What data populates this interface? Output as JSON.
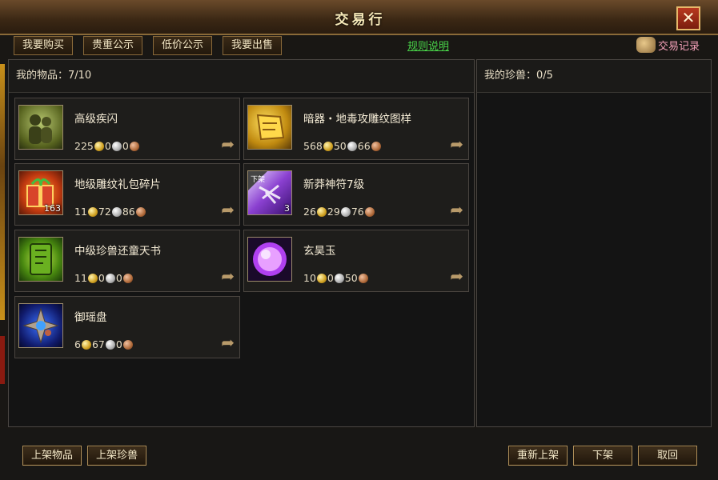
{
  "window": {
    "title": "交易行",
    "close_label": "✕"
  },
  "tabs": [
    {
      "label": "我要购买"
    },
    {
      "label": "贵重公示"
    },
    {
      "label": "低价公示"
    },
    {
      "label": "我要出售"
    }
  ],
  "rules_link": "规则说明",
  "records": {
    "label": "交易记录",
    "icon": "scroll-icon"
  },
  "left_panel": {
    "header": "我的物品：7/10"
  },
  "right_panel": {
    "header": "我的珍兽：0/5"
  },
  "items": [
    {
      "name": "高级疾闪",
      "count": "",
      "gold": "225",
      "silver": "0",
      "copper": "0",
      "icon": "shadow-figures-icon"
    },
    {
      "name": "暗器・地毒攻雕纹图样",
      "count": "",
      "gold": "568",
      "silver": "50",
      "copper": "66",
      "icon": "golden-scroll-icon"
    },
    {
      "name": "地级雕纹礼包碎片",
      "count": "163",
      "gold": "11",
      "silver": "72",
      "copper": "86",
      "icon": "gift-box-icon"
    },
    {
      "name": "新莽神符7级",
      "count": "3",
      "gold": "26",
      "silver": "29",
      "copper": "76",
      "icon": "talisman-icon",
      "badge": "下架"
    },
    {
      "name": "中级珍兽还童天书",
      "count": "",
      "gold": "11",
      "silver": "0",
      "copper": "0",
      "icon": "green-book-icon"
    },
    {
      "name": "玄昊玉",
      "count": "",
      "gold": "10",
      "silver": "0",
      "copper": "50",
      "icon": "purple-orb-icon"
    },
    {
      "name": "御瑶盘",
      "count": "",
      "gold": "6",
      "silver": "67",
      "copper": "0",
      "icon": "blue-star-disc-icon"
    }
  ],
  "bottom_buttons": {
    "list_item": "上架物品",
    "list_pet": "上架珍兽",
    "relist": "重新上架",
    "delist": "下架",
    "cancel": "取回"
  },
  "colors": {
    "accent": "#48d248",
    "border": "#b0905a",
    "records": "#f3a0b8"
  }
}
